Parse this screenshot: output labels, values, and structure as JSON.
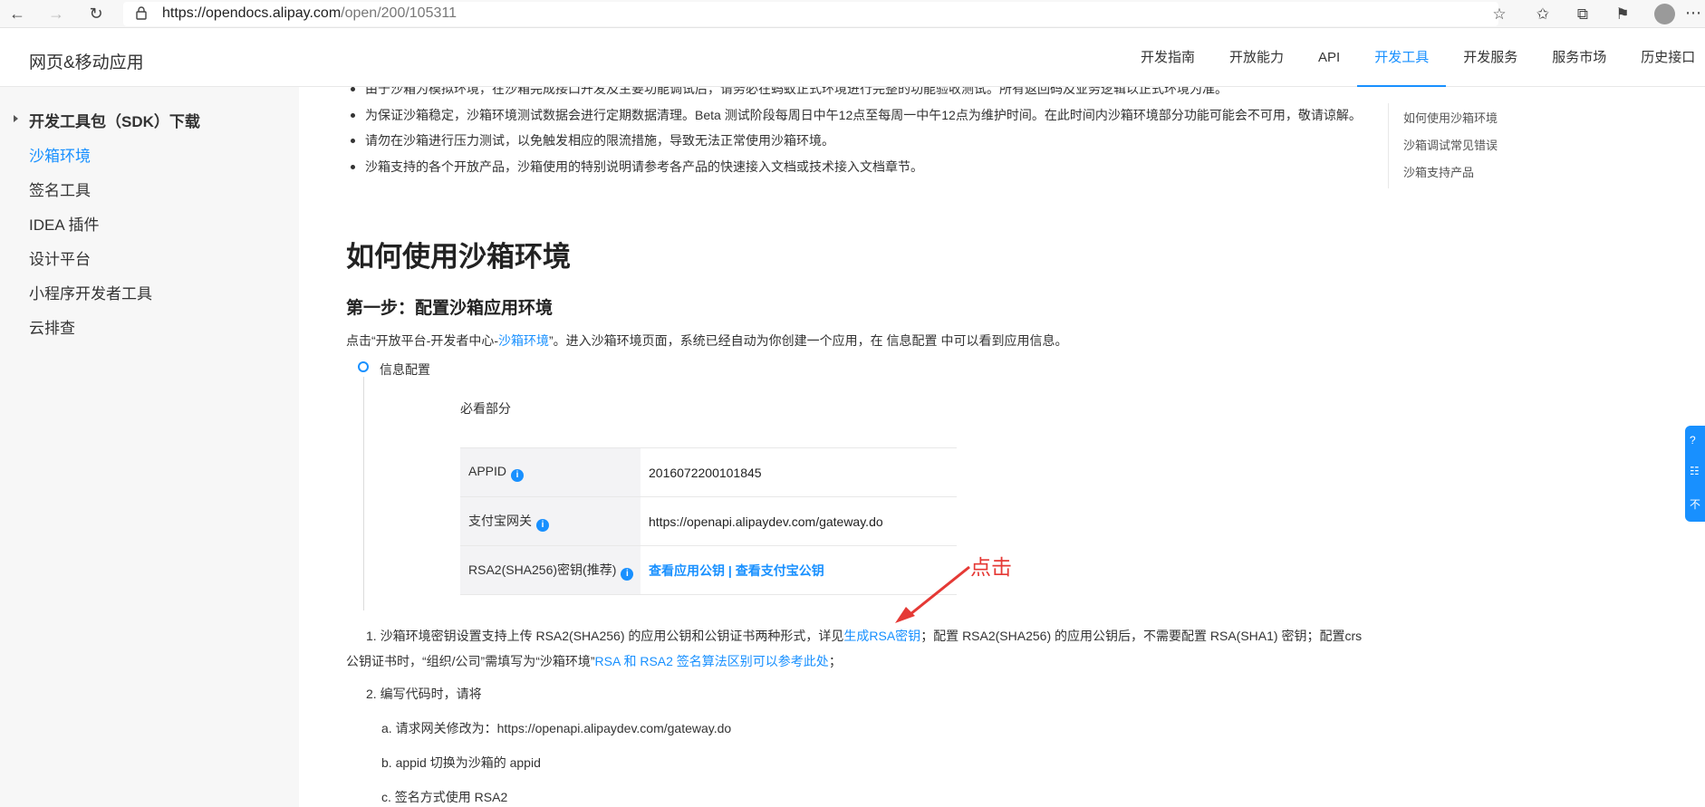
{
  "browser": {
    "url_host": "https://opendocs.alipay.com",
    "url_path": "/open/200/105311"
  },
  "header": {
    "brand": "网页&移动应用",
    "nav": [
      "开发指南",
      "开放能力",
      "API",
      "开发工具",
      "开发服务",
      "服务市场",
      "历史接口"
    ],
    "active_nav": "开发工具"
  },
  "sidebar": {
    "items": [
      "开发工具包（SDK）下载",
      "沙箱环境",
      "签名工具",
      "IDEA 插件",
      "设计平台",
      "小程序开发者工具",
      "云排查"
    ],
    "active": "沙箱环境"
  },
  "toc": {
    "items": [
      "如何使用沙箱环境",
      "沙箱调试常见错误",
      "沙箱支持产品"
    ]
  },
  "content": {
    "bullets": [
      "由于沙箱为模拟环境，在沙箱完成接口开发及主要功能调试后，请务必在蚂蚁正式环境进行完整的功能验收测试。所有返回码及业务逻辑以正式环境为准。",
      "为保证沙箱稳定，沙箱环境测试数据会进行定期数据清理。Beta 测试阶段每周日中午12点至每周一中午12点为维护时间。在此时间内沙箱环境部分功能可能会不可用，敬请谅解。",
      "请勿在沙箱进行压力测试，以免触发相应的限流措施，导致无法正常使用沙箱环境。",
      "沙箱支持的各个开放产品，沙箱使用的特别说明请参考各产品的快速接入文档或技术接入文档章节。"
    ],
    "h1": "如何使用沙箱环境",
    "h2": "第一步：配置沙箱应用环境",
    "para_pre": "点击“开放平台-开发者中心-",
    "para_link": "沙箱环境",
    "para_post": "”。进入沙箱环境页面，系统已经自动为你创建一个应用，在 信息配置 中可以看到应用信息。",
    "timeline_title": "信息配置",
    "must_read": "必看部分",
    "table": [
      {
        "key": "APPID",
        "value": "2016072200101845"
      },
      {
        "key": "支付宝网关",
        "value": "https://openapi.alipaydev.com/gateway.do"
      },
      {
        "key": "RSA2(SHA256)密钥(推荐)",
        "value_link1": "查看应用公钥",
        "sep": " | ",
        "value_link2": "查看支付宝公钥"
      }
    ],
    "note1_pre": "1. 沙箱环境密钥设置支持上传 RSA2(SHA256) 的应用公钥和公钥证书两种形式，详见",
    "note1_link1": "生成RSA密钥",
    "note1_mid": "；配置 RSA2(SHA256) 的应用公钥后，不需要配置 RSA(SHA1) 密钥；配置crs公钥证书时，“组织/公司”需填写为“沙箱环境”",
    "note1_link2": "RSA 和 RSA2 签名算法区别可以参考此处",
    "note1_end": "；",
    "num2": "2. 编写代码时，请将",
    "subs": [
      "a. 请求网关修改为：https://openapi.alipaydev.com/gateway.do",
      "b. appid 切换为沙箱的 appid",
      "c. 签名方式使用 RSA2"
    ]
  },
  "annotation": {
    "text": "点击",
    "color": "#e53935"
  },
  "float_tab": {
    "glyphs": [
      "?",
      "☷",
      "不"
    ]
  },
  "colors": {
    "accent": "#1890ff",
    "sidebar_bg": "#f7f7f7"
  }
}
